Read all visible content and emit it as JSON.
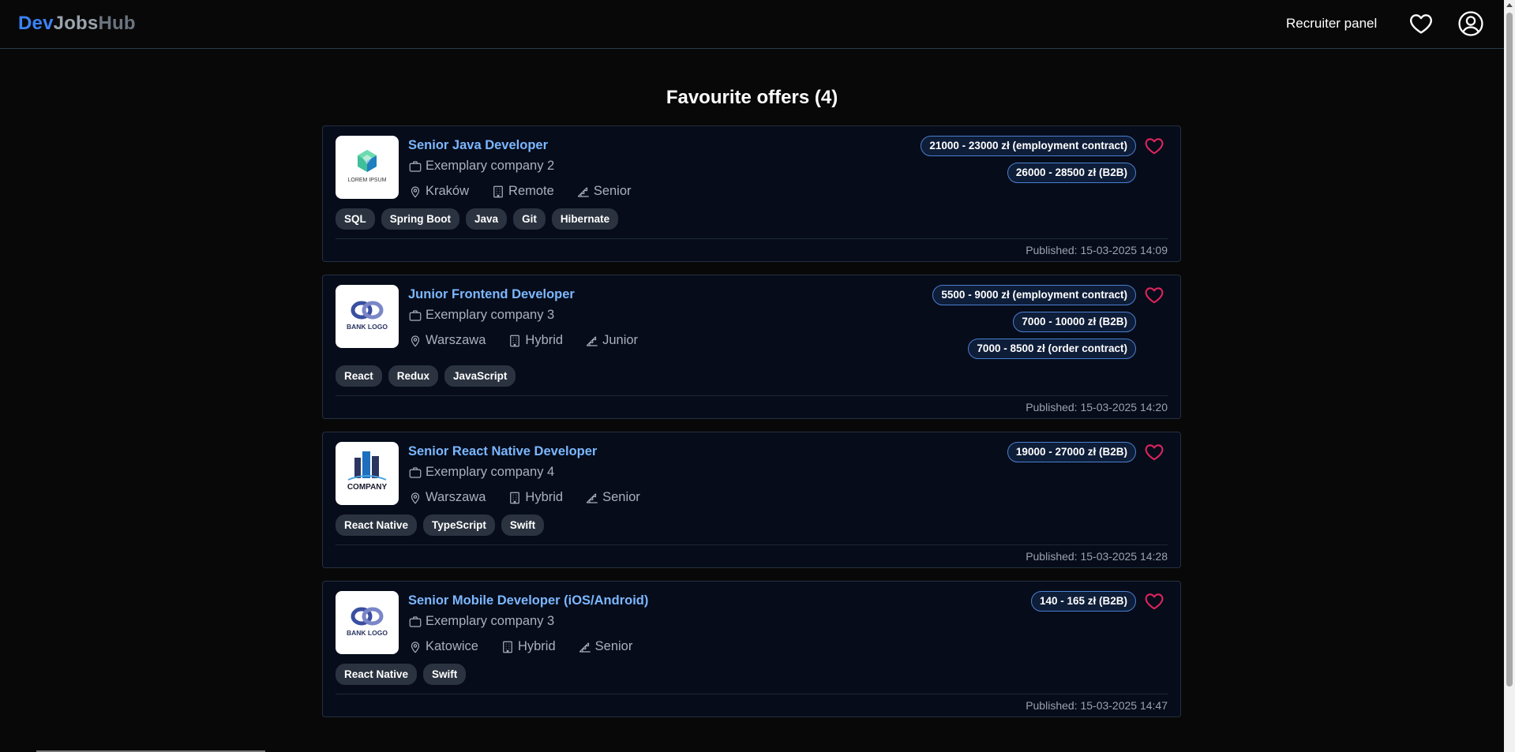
{
  "app": {
    "brand": [
      "Dev",
      "Jobs",
      "Hub"
    ],
    "brand_colors": [
      "#3b82f6",
      "#9aa3ad",
      "#6b7480"
    ]
  },
  "nav": {
    "recruiter_panel": "Recruiter panel",
    "favourites_icon": "heart-icon",
    "profile_icon": "user-circle-icon"
  },
  "page": {
    "title": "Favourite offers (4)"
  },
  "colors": {
    "accent": "#7cb7ff",
    "favourite": "#e0245e",
    "card_bg": "#060c1a",
    "card_border": "#243042",
    "tag_bg": "#2b3340",
    "salary_border": "#4a7fcf"
  },
  "offers": [
    {
      "logo": "LOREM IPSUM",
      "title": "Senior Java Developer",
      "company": "Exemplary company 2",
      "location": "Kraków",
      "work_mode": "Remote",
      "level": "Senior",
      "tags": [
        "SQL",
        "Spring Boot",
        "Java",
        "Git",
        "Hibernate"
      ],
      "salaries": [
        "21000 - 23000 zł (employment contract)",
        "26000 - 28500 zł (B2B)"
      ],
      "published": "Published: 15-03-2025 14:09",
      "favourite": true
    },
    {
      "logo": "BANK LOGO",
      "title": "Junior Frontend Developer",
      "company": "Exemplary company 3",
      "location": "Warszawa",
      "work_mode": "Hybrid",
      "level": "Junior",
      "tags": [
        "React",
        "Redux",
        "JavaScript"
      ],
      "salaries": [
        "5500 - 9000 zł (employment contract)",
        "7000 - 10000 zł (B2B)",
        "7000 - 8500 zł (order contract)"
      ],
      "published": "Published: 15-03-2025 14:20",
      "favourite": true
    },
    {
      "logo": "COMPANY",
      "title": "Senior React Native Developer",
      "company": "Exemplary company 4",
      "location": "Warszawa",
      "work_mode": "Hybrid",
      "level": "Senior",
      "tags": [
        "React Native",
        "TypeScript",
        "Swift"
      ],
      "salaries": [
        "19000 - 27000 zł (B2B)"
      ],
      "published": "Published: 15-03-2025 14:28",
      "favourite": true
    },
    {
      "logo": "BANK LOGO",
      "title": "Senior Mobile Developer (iOS/Android)",
      "company": "Exemplary company 3",
      "location": "Katowice",
      "work_mode": "Hybrid",
      "level": "Senior",
      "tags": [
        "React Native",
        "Swift"
      ],
      "salaries": [
        "140 - 165 zł (B2B)"
      ],
      "published": "Published: 15-03-2025 14:47",
      "favourite": true
    }
  ]
}
